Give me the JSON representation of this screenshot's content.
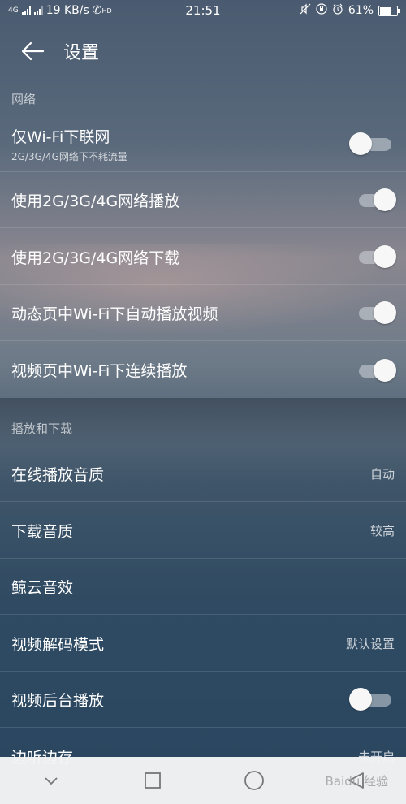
{
  "status_bar": {
    "network": "4G",
    "speed": "19 KB/s",
    "hd": "HD",
    "time": "21:51",
    "battery": "61%",
    "battery_level": 0.61
  },
  "header": {
    "title": "设置"
  },
  "sections": [
    {
      "title": "网络",
      "items": [
        {
          "label": "仅Wi-Fi下联网",
          "sub": "2G/3G/4G网络下不耗流量",
          "toggle": false
        },
        {
          "label": "使用2G/3G/4G网络播放",
          "toggle": true
        },
        {
          "label": "使用2G/3G/4G网络下载",
          "toggle": true
        },
        {
          "label": "动态页中Wi-Fi下自动播放视频",
          "toggle": true
        },
        {
          "label": "视频页中Wi-Fi下连续播放",
          "toggle": true
        }
      ]
    },
    {
      "title": "播放和下载",
      "items": [
        {
          "label": "在线播放音质",
          "value": "自动"
        },
        {
          "label": "下载音质",
          "value": "较高"
        },
        {
          "label": "鲸云音效"
        },
        {
          "label": "视频解码模式",
          "value": "默认设置"
        },
        {
          "label": "视频后台播放",
          "toggle": false
        },
        {
          "label": "边听边存",
          "value": "未开启"
        }
      ]
    }
  ],
  "watermark": "Baidu 经验"
}
